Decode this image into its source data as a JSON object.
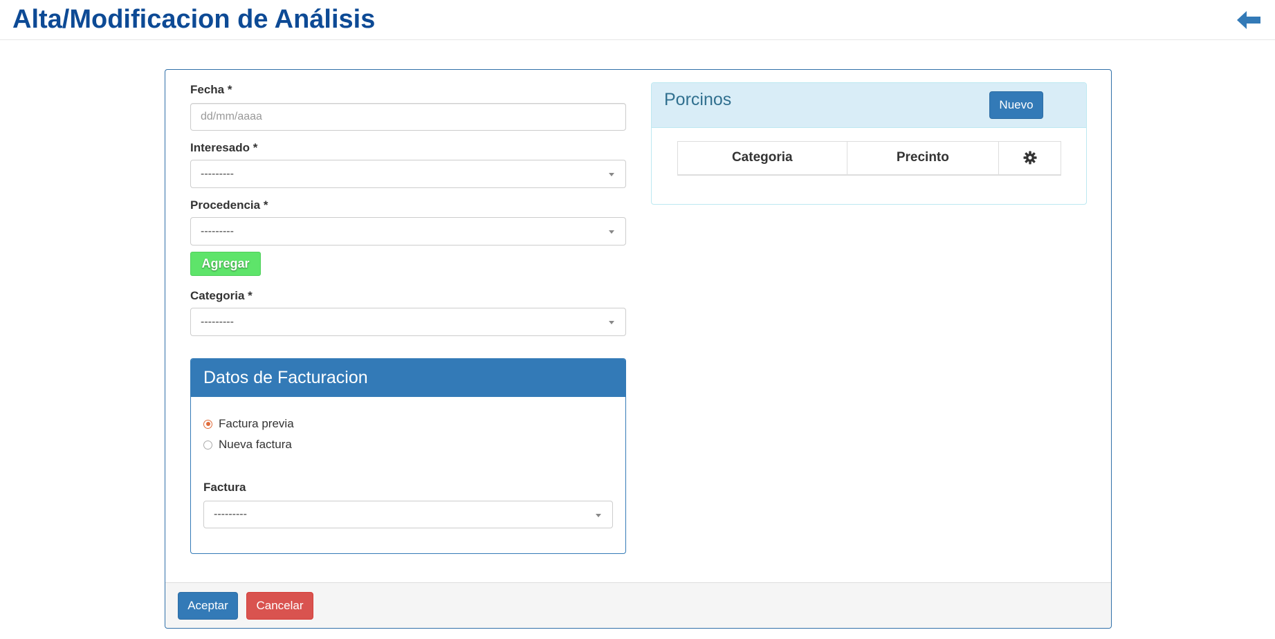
{
  "header": {
    "title": "Alta/Modificacion de Análisis",
    "back_icon": "arrow-left-icon",
    "accent_color": "#0d4a95"
  },
  "form": {
    "fecha": {
      "label": "Fecha *",
      "placeholder": "dd/mm/aaaa",
      "value": ""
    },
    "interesado": {
      "label": "Interesado *",
      "value": "---------"
    },
    "procedencia": {
      "label": "Procedencia *",
      "value": "---------"
    },
    "agregar_label": "Agregar",
    "categoria": {
      "label": "Categoria *",
      "value": "---------"
    }
  },
  "facturacion": {
    "title": "Datos de Facturacion",
    "options": [
      {
        "label": "Factura previa",
        "checked": true
      },
      {
        "label": "Nueva factura",
        "checked": false
      }
    ],
    "factura": {
      "label": "Factura",
      "value": "---------"
    }
  },
  "porcinos": {
    "title": "Porcinos",
    "nuevo_label": "Nuevo",
    "columns": [
      "Categoria",
      "Precinto"
    ],
    "settings_icon": "gear-icon",
    "rows": []
  },
  "footer": {
    "aceptar_label": "Aceptar",
    "cancelar_label": "Cancelar"
  },
  "colors": {
    "primary": "#337ab7",
    "danger": "#d9534f",
    "success": "#5ee46a",
    "info_bg": "#d9edf7"
  }
}
